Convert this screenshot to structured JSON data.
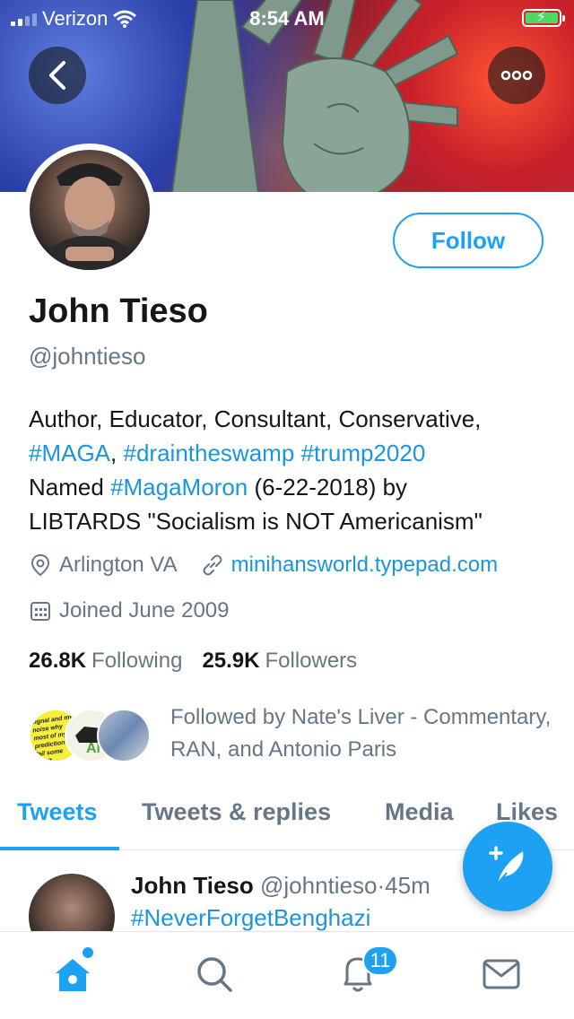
{
  "status_bar": {
    "carrier": "Verizon",
    "time": "8:54 AM",
    "battery": "charging"
  },
  "header": {
    "back_icon": "chevron-left-icon",
    "more_icon": "ellipsis-icon"
  },
  "profile": {
    "name": "John Tieso",
    "handle": "@johntieso",
    "follow_label": "Follow",
    "bio": {
      "line1": "Author, Educator, Consultant, Conservative,",
      "tag_maga": "#MAGA",
      "comma": ",",
      "tag_swamp": "#draintheswamp",
      "tag_trump": "#trump2020",
      "named": "Named",
      "tag_magamoron": "#MagaMoron",
      "date_by": "(6-22-2018) by",
      "line4": "LIBTARDS \"Socialism is NOT Americanism\""
    },
    "location": "Arlington VA",
    "website": "minihansworld.typepad.com",
    "joined": "Joined June 2009",
    "following_count": "26.8K",
    "following_label": "Following",
    "followers_count": "25.9K",
    "followers_label": "Followers",
    "followed_by": "Followed by Nate's Liver - Commentary, RAN, and Antonio Paris",
    "mini_avatar_text1": "signal and my noise why most of my predictions fail some don't",
    "mini_avatar_text2": "AN"
  },
  "tabs": [
    {
      "label": "Tweets",
      "active": true
    },
    {
      "label": "Tweets & replies",
      "active": false
    },
    {
      "label": "Media",
      "active": false
    },
    {
      "label": "Likes",
      "active": false
    }
  ],
  "tweet": {
    "author": "John Tieso",
    "handle": "@johntieso",
    "separator": "·",
    "age": "45m",
    "text": "#NeverForgetBenghazi"
  },
  "bottom_nav": {
    "notifications_badge": "11"
  },
  "colors": {
    "accent": "#1da1f2",
    "link": "#1b95e0",
    "secondary_text": "#657786",
    "primary_text": "#14171a"
  }
}
